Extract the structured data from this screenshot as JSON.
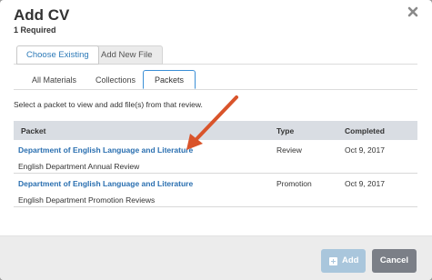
{
  "header": {
    "title": "Add CV",
    "subtitle": "1 Required",
    "close_icon": "close-icon"
  },
  "top_tabs": [
    {
      "label": "Choose Existing",
      "active": true
    },
    {
      "label": "Add New File",
      "active": false
    }
  ],
  "sub_tabs": [
    {
      "label": "All Materials",
      "active": false
    },
    {
      "label": "Collections",
      "active": false
    },
    {
      "label": "Packets",
      "active": true
    }
  ],
  "instruction": "Select a packet to view and add file(s) from that review.",
  "table": {
    "columns": [
      "Packet",
      "Type",
      "Completed"
    ],
    "rows": [
      {
        "name": "Department of English Language and Literature",
        "description": "English Department Annual Review",
        "type": "Review",
        "completed": "Oct 9, 2017"
      },
      {
        "name": "Department of English Language and Literature",
        "description": "English Department Promotion Reviews",
        "type": "Promotion",
        "completed": "Oct 9, 2017"
      }
    ]
  },
  "footer": {
    "add_label": "Add",
    "cancel_label": "Cancel"
  },
  "colors": {
    "link": "#2a6fb0",
    "add_button": "#a9c6dc",
    "cancel_button": "#7b7f87",
    "arrow": "#d9542b"
  }
}
